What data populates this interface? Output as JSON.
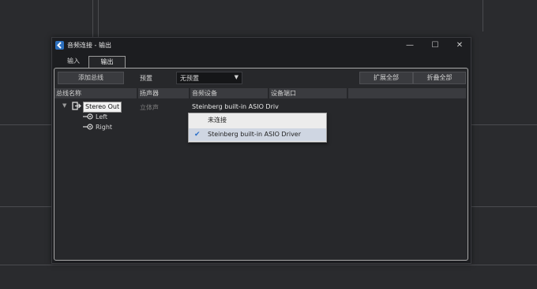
{
  "window": {
    "title": "音频连接 - 输出",
    "minimize_glyph": "—",
    "maximize_glyph": "☐",
    "close_glyph": "✕"
  },
  "tabs": [
    {
      "label": "输入",
      "active": false
    },
    {
      "label": "输出",
      "active": true
    }
  ],
  "toolbar": {
    "add_bus": "添加总线",
    "preset_label": "预置",
    "preset_value": "无预置",
    "expand_all": "扩展全部",
    "collapse_all": "折叠全部"
  },
  "columns": [
    "总线名称",
    "扬声器",
    "音频设备",
    "设备端口"
  ],
  "tree": {
    "bus_name": "Stereo Out",
    "speaker": "立体声",
    "device": "Steinberg built-in ASIO Driv",
    "children": [
      "Left",
      "Right"
    ]
  },
  "dropdown": {
    "items": [
      {
        "label": "未连接",
        "selected": false
      },
      {
        "label": "Steinberg built-in ASIO Driver",
        "selected": true
      }
    ]
  },
  "icons": {
    "app": "cubase-icon",
    "expand": "triangle-down-icon",
    "output": "output-bus-icon",
    "channel": "channel-port-icon",
    "check": "checkmark-icon"
  },
  "colors": {
    "accent": "#2c6fbd",
    "selection": "#cfd6e2",
    "check": "#2a6fc9"
  }
}
